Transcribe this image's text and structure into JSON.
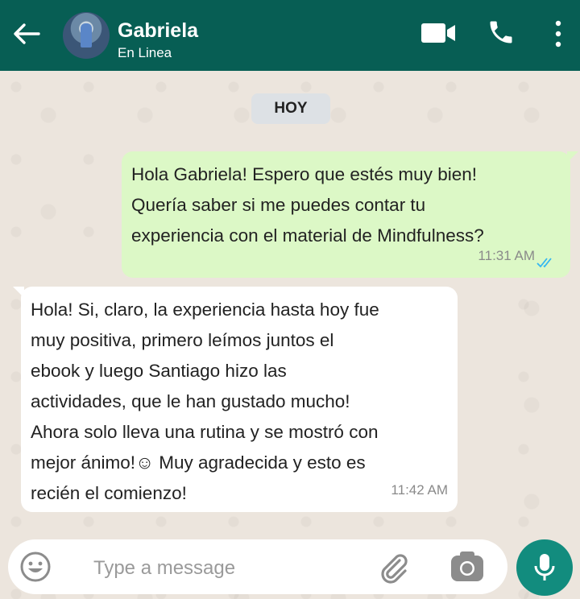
{
  "header": {
    "contact_name": "Gabriela",
    "status": "En Linea",
    "icons": [
      "back-arrow-icon",
      "video-call-icon",
      "phone-icon",
      "more-options-icon"
    ]
  },
  "chat": {
    "day_label": "HOY",
    "messages": [
      {
        "direction": "outgoing",
        "lines": [
          "Hola Gabriela! Espero que estés muy bien!",
          "Quería saber si me puedes contar tu",
          "experiencia con el material de Mindfulness?"
        ],
        "time": "11:31 AM",
        "read_status": "double-check-blue"
      },
      {
        "direction": "incoming",
        "lines": [
          "Hola! Si, claro, la experiencia hasta hoy fue",
          "muy positiva, primero leímos juntos el",
          "ebook y luego Santiago hizo las",
          "actividades, que le han gustado mucho!",
          "Ahora solo lleva una rutina y se mostró con",
          "mejor ánimo!☺  Muy agradecida y esto es",
          "recién el comienzo!"
        ],
        "time": "11:42 AM"
      }
    ]
  },
  "composer": {
    "placeholder": "Type a message",
    "icons": [
      "emoji-icon",
      "attach-icon",
      "camera-icon",
      "mic-icon"
    ]
  },
  "colors": {
    "header_bg": "#075e54",
    "outgoing_bubble": "#dcf8c6",
    "incoming_bubble": "#ffffff",
    "mic_button": "#128c7e",
    "read_ticks": "#34b7f1"
  }
}
